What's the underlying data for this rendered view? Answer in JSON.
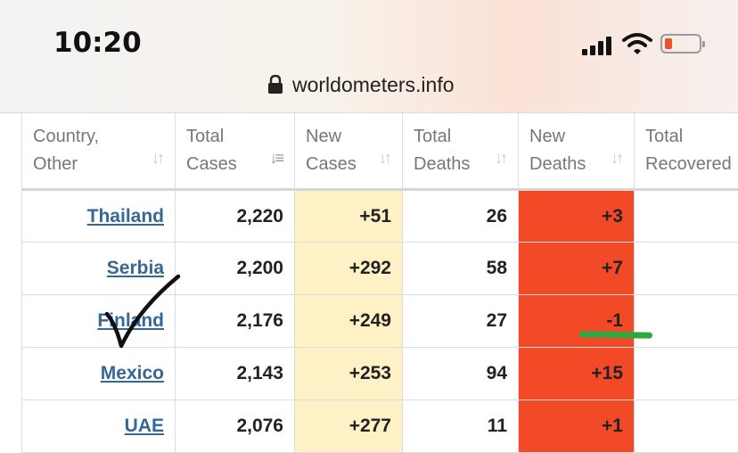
{
  "status_bar": {
    "time": "10:20"
  },
  "browser": {
    "url": "worldometers.info"
  },
  "table": {
    "columns": [
      {
        "line1": "Country,",
        "line2": "Other"
      },
      {
        "line1": "Total",
        "line2": "Cases"
      },
      {
        "line1": "New",
        "line2": "Cases"
      },
      {
        "line1": "Total",
        "line2": "Deaths"
      },
      {
        "line1": "New",
        "line2": "Deaths"
      },
      {
        "line1": "Total",
        "line2": "Recovered"
      }
    ],
    "rows": [
      {
        "country": "Thailand",
        "total_cases": "2,220",
        "new_cases": "+51",
        "total_deaths": "26",
        "new_deaths": "+3"
      },
      {
        "country": "Serbia",
        "total_cases": "2,200",
        "new_cases": "+292",
        "total_deaths": "58",
        "new_deaths": "+7"
      },
      {
        "country": "Finland",
        "total_cases": "2,176",
        "new_cases": "+249",
        "total_deaths": "27",
        "new_deaths": "-1"
      },
      {
        "country": "Mexico",
        "total_cases": "2,143",
        "new_cases": "+253",
        "total_deaths": "94",
        "new_deaths": "+15"
      },
      {
        "country": "UAE",
        "total_cases": "2,076",
        "new_cases": "+277",
        "total_deaths": "11",
        "new_deaths": "+1"
      }
    ]
  },
  "colors": {
    "new_cases_bg": "#fff1c6",
    "new_deaths_bg": "#f24a27",
    "link": "#366796",
    "annotation_check": "#111111",
    "annotation_underline": "#2ea83f"
  }
}
